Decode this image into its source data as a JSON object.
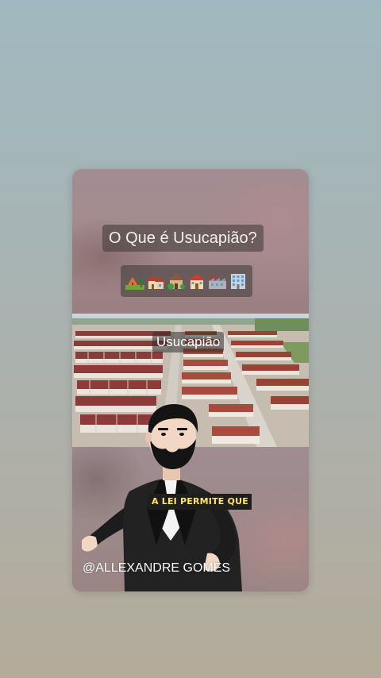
{
  "video": {
    "title": "O Que é Usucapião?",
    "emoji_row": [
      "camping-emoji",
      "houses-emoji",
      "derelict-house-emoji",
      "house-emoji",
      "factory-emoji",
      "office-building-emoji"
    ],
    "photo_label": "Usucapião",
    "subtitle": "A LEI PERMITE QUE",
    "watermark": "@ALLEXANDRE GOMES"
  },
  "colors": {
    "background_top": "#9fb8bf",
    "background_bottom": "#b4ab9a",
    "subtitle_text": "#ffe46a",
    "subtitle_bg": "#1e1e1e",
    "roof_red": "#8e3a3a"
  }
}
